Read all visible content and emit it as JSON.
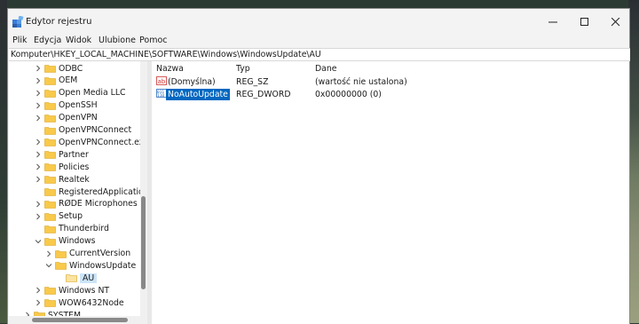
{
  "window": {
    "title": "Edytor rejestru"
  },
  "menu": [
    "Plik",
    "Edycja",
    "Widok",
    "Ulubione",
    "Pomoc"
  ],
  "address": "Komputer\\HKEY_LOCAL_MACHINE\\SOFTWARE\\Windows\\WindowsUpdate\\AU",
  "tree": [
    {
      "label": "ODBC",
      "chevron": "right"
    },
    {
      "label": "OEM",
      "chevron": "right"
    },
    {
      "label": "Open Media LLC",
      "chevron": "right"
    },
    {
      "label": "OpenSSH",
      "chevron": "right"
    },
    {
      "label": "OpenVPN",
      "chevron": "right"
    },
    {
      "label": "OpenVPNConnect",
      "chevron": "none"
    },
    {
      "label": "OpenVPNConnect.exe",
      "chevron": "right"
    },
    {
      "label": "Partner",
      "chevron": "right"
    },
    {
      "label": "Policies",
      "chevron": "right"
    },
    {
      "label": "Realtek",
      "chevron": "right"
    },
    {
      "label": "RegisteredApplications",
      "chevron": "none"
    },
    {
      "label": "RØDE Microphones",
      "chevron": "right"
    },
    {
      "label": "Setup",
      "chevron": "right"
    },
    {
      "label": "Thunderbird",
      "chevron": "none"
    },
    {
      "label": "Windows",
      "chevron": "down"
    },
    {
      "label": "CurrentVersion",
      "chevron": "right"
    },
    {
      "label": "WindowsUpdate",
      "chevron": "down"
    },
    {
      "label": "AU",
      "chevron": "none",
      "selected": true
    },
    {
      "label": "Windows NT",
      "chevron": "right"
    },
    {
      "label": "WOW6432Node",
      "chevron": "right"
    },
    {
      "label": "SYSTEM",
      "chevron": "right"
    }
  ],
  "columns": {
    "name": "Nazwa",
    "type": "Typ",
    "data": "Dane"
  },
  "values": [
    {
      "name": "(Domyślna)",
      "type": "REG_SZ",
      "data": "(wartość nie ustalona)",
      "icon": "string-value-icon"
    },
    {
      "name": "NoAutoUpdate",
      "type": "REG_DWORD",
      "data": "0x00000000 (0)",
      "icon": "dword-value-icon",
      "selected": true
    }
  ],
  "colors": {
    "selection": "#0067c0",
    "folder": "#f8c94a",
    "folder_selected": "#fbe3a0"
  }
}
